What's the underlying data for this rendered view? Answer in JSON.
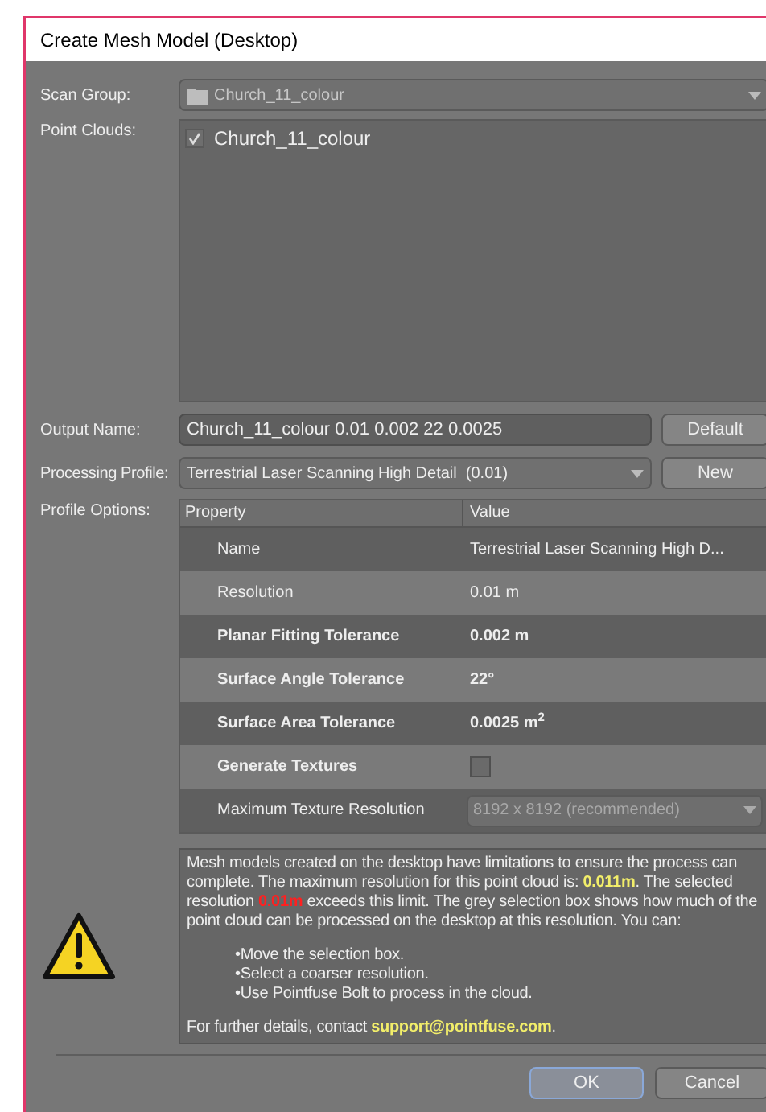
{
  "window": {
    "title": "Create Mesh Model (Desktop)"
  },
  "scan_group": {
    "label": "Scan Group:",
    "value": "Church_11_colour"
  },
  "point_clouds": {
    "label": "Point Clouds:",
    "items": [
      {
        "name": "Church_11_colour",
        "checked": true
      }
    ]
  },
  "output_name": {
    "label": "Output Name:",
    "value": "Church_11_colour 0.01 0.002 22 0.0025",
    "button": "Default"
  },
  "processing_profile": {
    "label": "Processing Profile:",
    "value": "Terrestrial Laser Scanning High Detail  (0.01)",
    "button": "New"
  },
  "profile_options": {
    "label": "Profile Options:",
    "columns": [
      "Property",
      "Value"
    ],
    "rows": [
      {
        "kind": "text",
        "property": "Name",
        "value": "Terrestrial Laser Scanning High D...",
        "emphasized": false
      },
      {
        "kind": "text",
        "property": "Resolution",
        "value": "0.01 m",
        "emphasized": false
      },
      {
        "kind": "text",
        "property": "Planar Fitting Tolerance",
        "value": "0.002 m",
        "emphasized": true
      },
      {
        "kind": "text",
        "property": "Surface Angle Tolerance",
        "value": "22°",
        "emphasized": true
      },
      {
        "kind": "text",
        "property": "Surface Area Tolerance",
        "value": "0.0025 m$^{2}$",
        "emphasized": true
      },
      {
        "kind": "checkbox",
        "property": "Generate Textures",
        "checked": false,
        "emphasized": true
      },
      {
        "kind": "dropdown",
        "property": "Maximum Texture Resolution",
        "value": "8192 x 8192 (recommended)",
        "disabled": true,
        "emphasized": false
      }
    ]
  },
  "message": {
    "paragraph": [
      {
        "kind": "plain",
        "text": "Mesh models created on the desktop have limitations to ensure the process can complete. The maximum resolution for this point cloud is: "
      },
      {
        "kind": "highlight",
        "text": "0.011m"
      },
      {
        "kind": "plain",
        "text": ". The selected resolution "
      },
      {
        "kind": "error",
        "text": "0.01m"
      },
      {
        "kind": "plain",
        "text": " exceeds this limit. The grey selection box shows how much of the point cloud can be processed on the desktop at this resolution. You can:"
      }
    ],
    "bullets": [
      "•Move the selection box.",
      "•Select a coarser resolution.",
      "•Use Pointfuse Bolt to process in the cloud."
    ],
    "footer": [
      {
        "kind": "plain",
        "text": "For further details, contact "
      },
      {
        "kind": "highlight",
        "text": "support@pointfuse.com"
      },
      {
        "kind": "plain",
        "text": "."
      }
    ]
  },
  "buttons": [
    {
      "label": "OK",
      "default": true
    },
    {
      "label": "Cancel",
      "default": false
    }
  ]
}
